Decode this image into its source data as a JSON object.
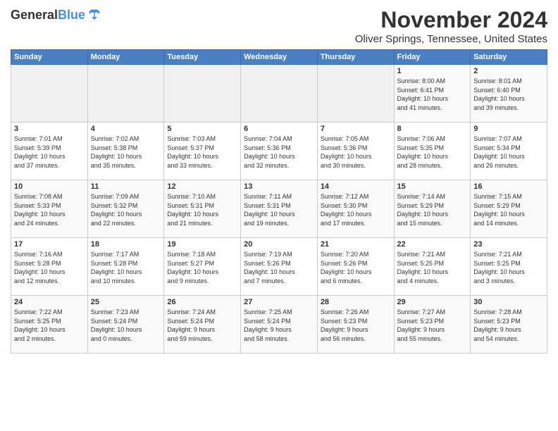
{
  "logo": {
    "line1": "General",
    "line2": "Blue",
    "bird": "▶"
  },
  "title": "November 2024",
  "location": "Oliver Springs, Tennessee, United States",
  "headers": [
    "Sunday",
    "Monday",
    "Tuesday",
    "Wednesday",
    "Thursday",
    "Friday",
    "Saturday"
  ],
  "weeks": [
    [
      {
        "day": "",
        "info": ""
      },
      {
        "day": "",
        "info": ""
      },
      {
        "day": "",
        "info": ""
      },
      {
        "day": "",
        "info": ""
      },
      {
        "day": "",
        "info": ""
      },
      {
        "day": "1",
        "info": "Sunrise: 8:00 AM\nSunset: 6:41 PM\nDaylight: 10 hours\nand 41 minutes."
      },
      {
        "day": "2",
        "info": "Sunrise: 8:01 AM\nSunset: 6:40 PM\nDaylight: 10 hours\nand 39 minutes."
      }
    ],
    [
      {
        "day": "3",
        "info": "Sunrise: 7:01 AM\nSunset: 5:39 PM\nDaylight: 10 hours\nand 37 minutes."
      },
      {
        "day": "4",
        "info": "Sunrise: 7:02 AM\nSunset: 5:38 PM\nDaylight: 10 hours\nand 35 minutes."
      },
      {
        "day": "5",
        "info": "Sunrise: 7:03 AM\nSunset: 5:37 PM\nDaylight: 10 hours\nand 33 minutes."
      },
      {
        "day": "6",
        "info": "Sunrise: 7:04 AM\nSunset: 5:36 PM\nDaylight: 10 hours\nand 32 minutes."
      },
      {
        "day": "7",
        "info": "Sunrise: 7:05 AM\nSunset: 5:36 PM\nDaylight: 10 hours\nand 30 minutes."
      },
      {
        "day": "8",
        "info": "Sunrise: 7:06 AM\nSunset: 5:35 PM\nDaylight: 10 hours\nand 28 minutes."
      },
      {
        "day": "9",
        "info": "Sunrise: 7:07 AM\nSunset: 5:34 PM\nDaylight: 10 hours\nand 26 minutes."
      }
    ],
    [
      {
        "day": "10",
        "info": "Sunrise: 7:08 AM\nSunset: 5:33 PM\nDaylight: 10 hours\nand 24 minutes."
      },
      {
        "day": "11",
        "info": "Sunrise: 7:09 AM\nSunset: 5:32 PM\nDaylight: 10 hours\nand 22 minutes."
      },
      {
        "day": "12",
        "info": "Sunrise: 7:10 AM\nSunset: 5:31 PM\nDaylight: 10 hours\nand 21 minutes."
      },
      {
        "day": "13",
        "info": "Sunrise: 7:11 AM\nSunset: 5:31 PM\nDaylight: 10 hours\nand 19 minutes."
      },
      {
        "day": "14",
        "info": "Sunrise: 7:12 AM\nSunset: 5:30 PM\nDaylight: 10 hours\nand 17 minutes."
      },
      {
        "day": "15",
        "info": "Sunrise: 7:14 AM\nSunset: 5:29 PM\nDaylight: 10 hours\nand 15 minutes."
      },
      {
        "day": "16",
        "info": "Sunrise: 7:15 AM\nSunset: 5:29 PM\nDaylight: 10 hours\nand 14 minutes."
      }
    ],
    [
      {
        "day": "17",
        "info": "Sunrise: 7:16 AM\nSunset: 5:28 PM\nDaylight: 10 hours\nand 12 minutes."
      },
      {
        "day": "18",
        "info": "Sunrise: 7:17 AM\nSunset: 5:28 PM\nDaylight: 10 hours\nand 10 minutes."
      },
      {
        "day": "19",
        "info": "Sunrise: 7:18 AM\nSunset: 5:27 PM\nDaylight: 10 hours\nand 9 minutes."
      },
      {
        "day": "20",
        "info": "Sunrise: 7:19 AM\nSunset: 5:26 PM\nDaylight: 10 hours\nand 7 minutes."
      },
      {
        "day": "21",
        "info": "Sunrise: 7:20 AM\nSunset: 5:26 PM\nDaylight: 10 hours\nand 6 minutes."
      },
      {
        "day": "22",
        "info": "Sunrise: 7:21 AM\nSunset: 5:25 PM\nDaylight: 10 hours\nand 4 minutes."
      },
      {
        "day": "23",
        "info": "Sunrise: 7:21 AM\nSunset: 5:25 PM\nDaylight: 10 hours\nand 3 minutes."
      }
    ],
    [
      {
        "day": "24",
        "info": "Sunrise: 7:22 AM\nSunset: 5:25 PM\nDaylight: 10 hours\nand 2 minutes."
      },
      {
        "day": "25",
        "info": "Sunrise: 7:23 AM\nSunset: 5:24 PM\nDaylight: 10 hours\nand 0 minutes."
      },
      {
        "day": "26",
        "info": "Sunrise: 7:24 AM\nSunset: 5:24 PM\nDaylight: 9 hours\nand 59 minutes."
      },
      {
        "day": "27",
        "info": "Sunrise: 7:25 AM\nSunset: 5:24 PM\nDaylight: 9 hours\nand 58 minutes."
      },
      {
        "day": "28",
        "info": "Sunrise: 7:26 AM\nSunset: 5:23 PM\nDaylight: 9 hours\nand 56 minutes."
      },
      {
        "day": "29",
        "info": "Sunrise: 7:27 AM\nSunset: 5:23 PM\nDaylight: 9 hours\nand 55 minutes."
      },
      {
        "day": "30",
        "info": "Sunrise: 7:28 AM\nSunset: 5:23 PM\nDaylight: 9 hours\nand 54 minutes."
      }
    ]
  ]
}
